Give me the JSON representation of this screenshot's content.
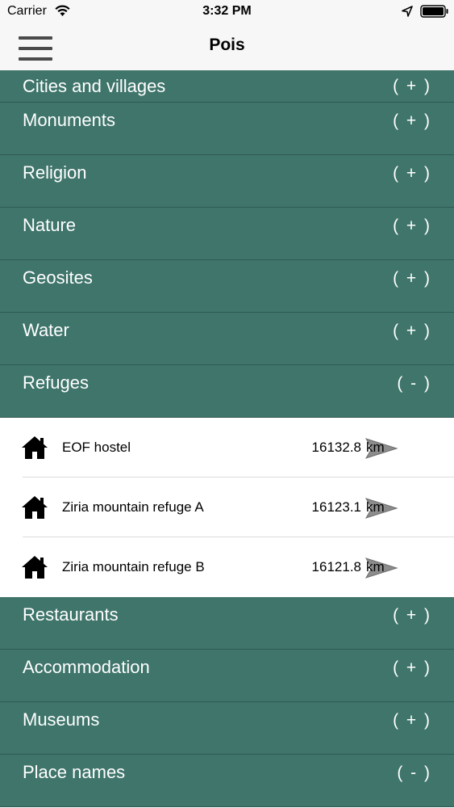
{
  "status_bar": {
    "carrier": "Carrier",
    "time": "3:32 PM"
  },
  "nav": {
    "title": "Pois"
  },
  "colors": {
    "category_bg": "#3f756b",
    "category_text": "#ffffff",
    "nav_bg": "#f7f7f7"
  },
  "categories_top": [
    {
      "label": "Cities and villages",
      "toggle": "( + )"
    },
    {
      "label": "Monuments",
      "toggle": "( + )"
    },
    {
      "label": "Religion",
      "toggle": "( + )"
    },
    {
      "label": "Nature",
      "toggle": "( + )"
    },
    {
      "label": "Geosites",
      "toggle": "( + )"
    },
    {
      "label": "Water",
      "toggle": "( + )"
    },
    {
      "label": "Refuges",
      "toggle": "( - )"
    }
  ],
  "refuges": [
    {
      "name": "EOF hostel",
      "distance": "16132.8",
      "unit": "km",
      "icon": "house-icon"
    },
    {
      "name": "Ziria mountain refuge A",
      "distance": "16123.1",
      "unit": "km",
      "icon": "house-icon"
    },
    {
      "name": "Ziria mountain refuge B",
      "distance": "16121.8",
      "unit": "km",
      "icon": "house-icon"
    }
  ],
  "categories_bottom": [
    {
      "label": "Restaurants",
      "toggle": "( + )"
    },
    {
      "label": "Accommodation",
      "toggle": "( + )"
    },
    {
      "label": "Museums",
      "toggle": "( + )"
    },
    {
      "label": "Place names",
      "toggle": "( - )"
    }
  ]
}
